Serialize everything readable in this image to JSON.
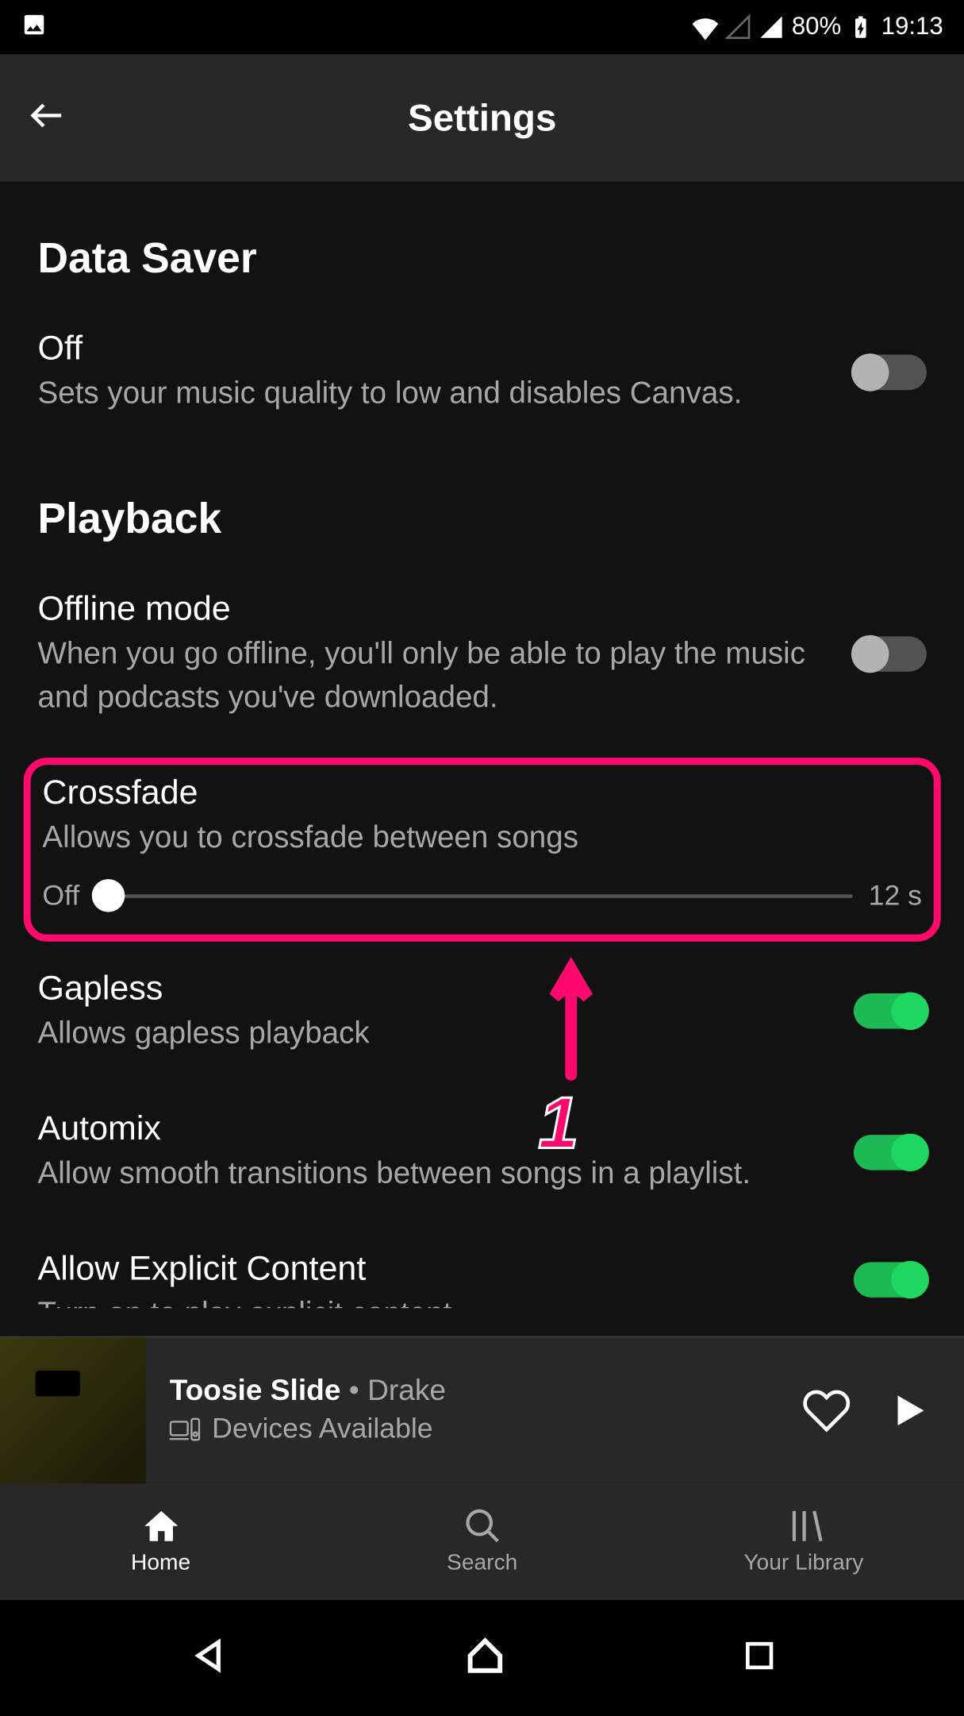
{
  "status": {
    "battery": "80%",
    "time": "19:13"
  },
  "header": {
    "title": "Settings"
  },
  "sections": {
    "data_saver": {
      "title": "Data Saver",
      "off_label": "Off",
      "off_desc": "Sets your music quality to low and disables Canvas."
    },
    "playback": {
      "title": "Playback",
      "offline_label": "Offline mode",
      "offline_desc": "When you go offline, you'll only be able to play the music and podcasts you've downloaded.",
      "crossfade_label": "Crossfade",
      "crossfade_desc": "Allows you to crossfade between songs",
      "crossfade_min": "Off",
      "crossfade_max": "12 s",
      "gapless_label": "Gapless",
      "gapless_desc": "Allows gapless playback",
      "automix_label": "Automix",
      "automix_desc": "Allow smooth transitions between songs in a playlist.",
      "explicit_label": "Allow Explicit Content",
      "explicit_desc": "Turn on to play explicit content"
    }
  },
  "annotation": {
    "number": "1"
  },
  "now_playing": {
    "track": "Toosie Slide",
    "separator": " • ",
    "artist": "Drake",
    "devices": "Devices Available"
  },
  "nav": {
    "home": "Home",
    "search": "Search",
    "library": "Your Library"
  }
}
